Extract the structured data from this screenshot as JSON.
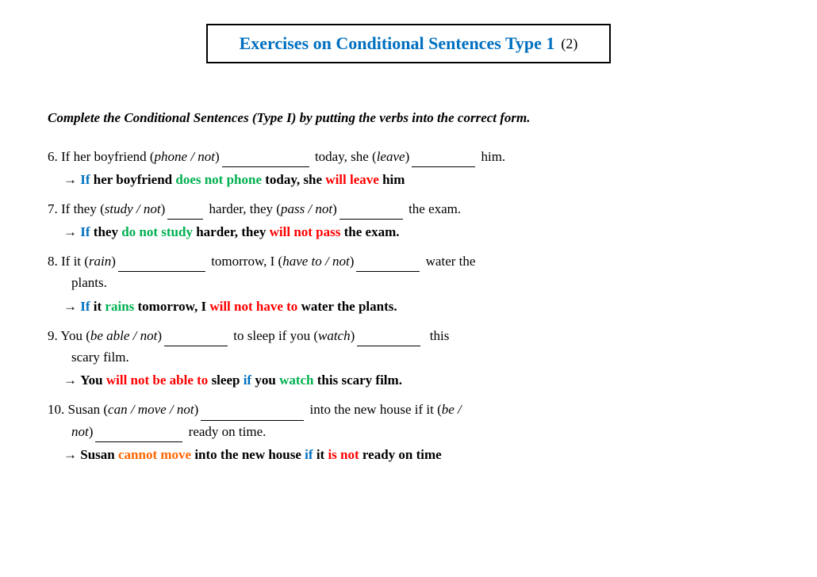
{
  "title": {
    "main": "Exercises on Conditional Sentences Type 1",
    "sub": "(2)"
  },
  "instructions": "Complete the Conditional Sentences (Type I) by putting the verbs into the correct form.",
  "exercises": [
    {
      "number": "6",
      "question": "If her boyfriend (<em>phone / not</em>) ___________ today, she (<em>leave</em>) __________ him.",
      "answer_arrow": "→",
      "answer": "If her boyfriend does not phone today, she will leave him"
    },
    {
      "number": "7",
      "question": "If they (<em>study / not</em>) _____ harder, they (<em>pass / not</em>) _________ the exam.",
      "answer_arrow": "→",
      "answer": "If they do not study harder, they will not pass the exam."
    },
    {
      "number": "8",
      "question": "If it (<em>rain</em>) ___________ tomorrow, I (<em>have to / not</em>) __________ water the plants.",
      "answer_arrow": "→",
      "answer": "If it rains tomorrow, I will not have to water the plants."
    },
    {
      "number": "9",
      "question": "You (<em>be able / not</em>) _________ to sleep if you (<em>watch</em>) _________ this scary film.",
      "answer_arrow": "→",
      "answer": "You will not be able to sleep if you watch this scary film."
    },
    {
      "number": "10",
      "question": "Susan (<em>can / move / not</em>) _______________ into the new house if it (<em>be / not</em>) ___________ ready on time.",
      "answer_arrow": "→",
      "answer": "Susan cannot move into the new house if it is not ready on time"
    }
  ]
}
